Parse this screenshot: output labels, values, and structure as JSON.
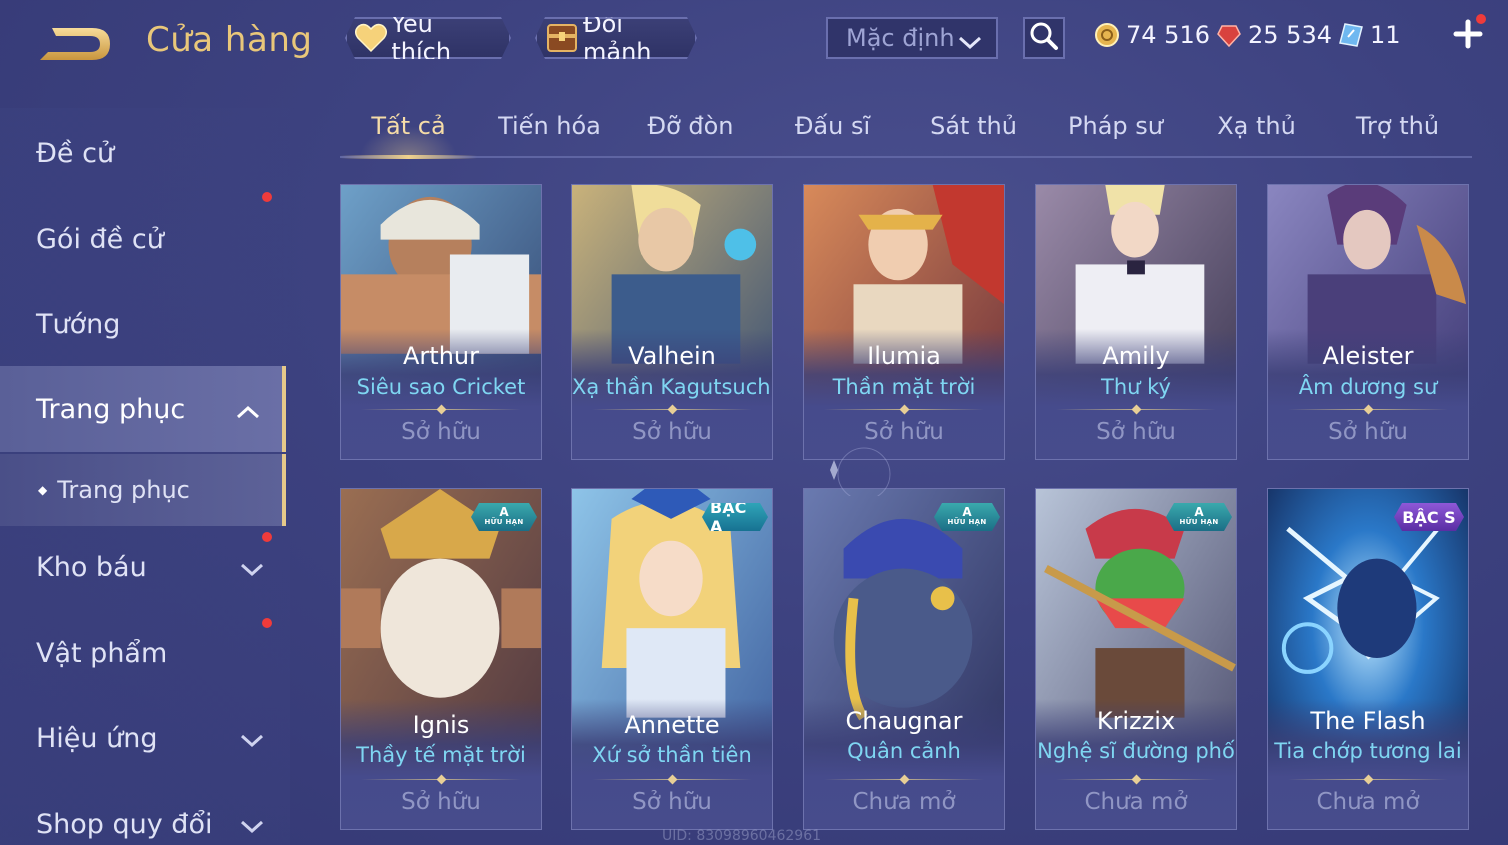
{
  "header": {
    "title": "Cửa hàng",
    "favorites_label": "Yêu thích",
    "shard_label": "Đổi mảnh",
    "sort_value": "Mặc định",
    "currency": [
      {
        "icon": "gold-coin-icon",
        "value": "74 516"
      },
      {
        "icon": "red-gem-icon",
        "value": "25 534"
      },
      {
        "icon": "voucher-icon",
        "value": "11"
      }
    ]
  },
  "sidebar": {
    "items": [
      {
        "label": "Đề cử",
        "dot": false,
        "arrow": "none"
      },
      {
        "label": "Gói đề cử",
        "dot": true,
        "arrow": "none"
      },
      {
        "label": "Tướng",
        "dot": false,
        "arrow": "none"
      },
      {
        "label": "Trang phục",
        "dot": false,
        "arrow": "up",
        "active": true
      },
      {
        "label": "Trang phục",
        "sub": true
      },
      {
        "label": "Kho báu",
        "dot": true,
        "arrow": "down"
      },
      {
        "label": "Vật phẩm",
        "dot": true,
        "arrow": "none"
      },
      {
        "label": "Hiệu ứng",
        "dot": false,
        "arrow": "down"
      },
      {
        "label": "Shop quy đổi",
        "dot": false,
        "arrow": "down"
      }
    ]
  },
  "tabs": [
    "Tất cả",
    "Tiến hóa",
    "Đỡ đòn",
    "Đấu sĩ",
    "Sát thủ",
    "Pháp sư",
    "Xạ thủ",
    "Trợ thủ"
  ],
  "active_tab": 0,
  "cards": [
    {
      "hero": "Arthur",
      "skin": "Siêu sao Cricket",
      "status": "Sở hữu",
      "badge": null
    },
    {
      "hero": "Valhein",
      "skin": "Xạ thần Kagutsuchi",
      "status": "Sở hữu",
      "badge": null
    },
    {
      "hero": "Ilumia",
      "skin": "Thần mặt trời",
      "status": "Sở hữu",
      "badge": null
    },
    {
      "hero": "Amily",
      "skin": "Thư ký",
      "status": "Sở hữu",
      "badge": null
    },
    {
      "hero": "Aleister",
      "skin": "Âm dương sư",
      "status": "Sở hữu",
      "badge": null
    },
    {
      "hero": "Ignis",
      "skin": "Thầy tế mặt trời",
      "status": "Sở hữu",
      "badge": {
        "type": "limited",
        "top": "A",
        "bottom": "HỮU HẠN"
      }
    },
    {
      "hero": "Annette",
      "skin": "Xứ sở thần tiên",
      "status": "Sở hữu",
      "badge": {
        "type": "tierA",
        "text": "BẬC A"
      }
    },
    {
      "hero": "Chaugnar",
      "skin": "Quân cảnh",
      "status": "Chưa mở",
      "badge": {
        "type": "limited",
        "top": "A",
        "bottom": "HỮU HẠN"
      }
    },
    {
      "hero": "Krizzix",
      "skin": "Nghệ sĩ đường phố",
      "status": "Chưa mở",
      "badge": {
        "type": "limited",
        "top": "A",
        "bottom": "HỮU HẠN"
      }
    },
    {
      "hero": "The Flash",
      "skin": "Tia chớp tương lai",
      "status": "Chưa mở",
      "badge": {
        "type": "tierS",
        "text": "BẬC S"
      }
    }
  ],
  "uid": "UID: 83098960462961",
  "colors": {
    "accent_gold": "#e9c77a",
    "skin_name": "#7fd6f2",
    "notify_dot": "#ef3b3b"
  }
}
